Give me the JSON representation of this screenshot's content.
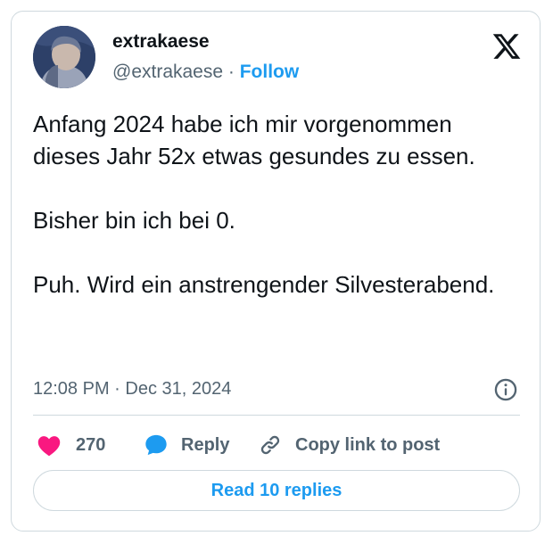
{
  "author": {
    "display_name": "extrakaese",
    "handle": "@extrakaese",
    "separator": "·",
    "follow_label": "Follow"
  },
  "tweet": {
    "text": "Anfang 2024 habe ich mir vorgenommen dieses Jahr 52x etwas gesundes zu essen.\n\nBisher bin ich bei 0.\n\nPuh. Wird ein anstrengender Silvesterabend.",
    "timestamp": "12:08 PM · Dec 31, 2024"
  },
  "actions": {
    "like_count": "270",
    "reply_label": "Reply",
    "copy_link_label": "Copy link to post"
  },
  "read_replies_label": "Read 10 replies",
  "icons": {
    "brand": "x-logo-icon",
    "info": "info-icon",
    "like": "heart-icon",
    "reply": "reply-bubble-icon",
    "copy": "link-icon"
  },
  "colors": {
    "accent": "#1d9bf0",
    "like": "#f91880",
    "text": "#0f1419",
    "muted": "#536471",
    "border": "#cfd9de"
  }
}
